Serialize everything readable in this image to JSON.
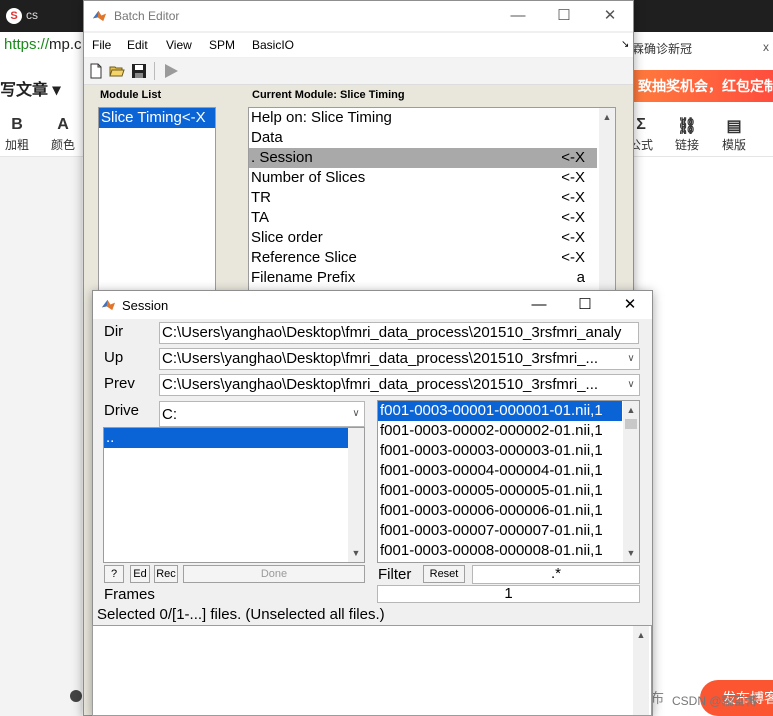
{
  "browser": {
    "tab_icon": "S",
    "tab_text": "cs",
    "url_scheme": "https://",
    "url_host": "mp.c",
    "topic_text": "霖确诊新冠",
    "close_glyph": "x",
    "banner_text": "致抽奖机会，红包定制",
    "article_label": "写文章 ▾",
    "tools_left": [
      {
        "icon": "B",
        "label": "加粗"
      },
      {
        "icon": "A",
        "label": "颜色"
      }
    ],
    "tools_right": [
      {
        "icon": "Σ",
        "label": "公式"
      },
      {
        "icon": "⛓",
        "label": "链接"
      },
      {
        "icon": "▤",
        "label": "模版"
      }
    ],
    "bottom_btn": "布",
    "csdn_text": "CSDN @糯宙博",
    "publish_text": "发布博客"
  },
  "batch_editor": {
    "title": "Batch Editor",
    "menu": [
      "File",
      "Edit",
      "View",
      "SPM",
      "BasicIO"
    ],
    "module_list_title": "Module List",
    "module_list": [
      "Slice Timing<-X"
    ],
    "current_module_title": "Current Module: Slice Timing",
    "current_module_rows": [
      {
        "label": "Help on: Slice Timing",
        "value": ""
      },
      {
        "label": "Data",
        "value": ""
      },
      {
        "label": ". Session",
        "value": "<-X"
      },
      {
        "label": "Number of Slices",
        "value": "<-X"
      },
      {
        "label": "TR",
        "value": "<-X"
      },
      {
        "label": "TA",
        "value": "<-X"
      },
      {
        "label": "Slice order",
        "value": "<-X"
      },
      {
        "label": "Reference Slice",
        "value": "<-X"
      },
      {
        "label": "Filename Prefix",
        "value": "a"
      }
    ]
  },
  "session": {
    "title": "Session",
    "dir_label": "Dir",
    "dir_value": "C:\\Users\\yanghao\\Desktop\\fmri_data_process\\201510_3rsfmri_analy",
    "up_label": "Up",
    "up_value": "C:\\Users\\yanghao\\Desktop\\fmri_data_process\\201510_3rsfmri_...",
    "prev_label": "Prev",
    "prev_value": "C:\\Users\\yanghao\\Desktop\\fmri_data_process\\201510_3rsfmri_...",
    "drive_label": "Drive",
    "drive_value": "C:",
    "dir_list": [
      ".."
    ],
    "files": [
      "f001-0003-00001-000001-01.nii,1",
      "f001-0003-00002-000002-01.nii,1",
      "f001-0003-00003-000003-01.nii,1",
      "f001-0003-00004-000004-01.nii,1",
      "f001-0003-00005-000005-01.nii,1",
      "f001-0003-00006-000006-01.nii,1",
      "f001-0003-00007-000007-01.nii,1",
      "f001-0003-00008-000008-01.nii,1"
    ],
    "btn_help": "?",
    "btn_ed": "Ed",
    "btn_rec": "Rec",
    "btn_done": "Done",
    "filter_label": "Filter",
    "reset_label": "Reset",
    "filter_value": ".*",
    "frames_label": "Frames",
    "frames_value": "1",
    "status": "Selected 0/[1-...] files. (Unselected all files.)"
  },
  "colors": {
    "selection_blue": "#0a64d6",
    "selection_gray": "#a9a9a9",
    "panel_beige": "#e9e7dc",
    "csdn_orange": "#fc5531"
  }
}
